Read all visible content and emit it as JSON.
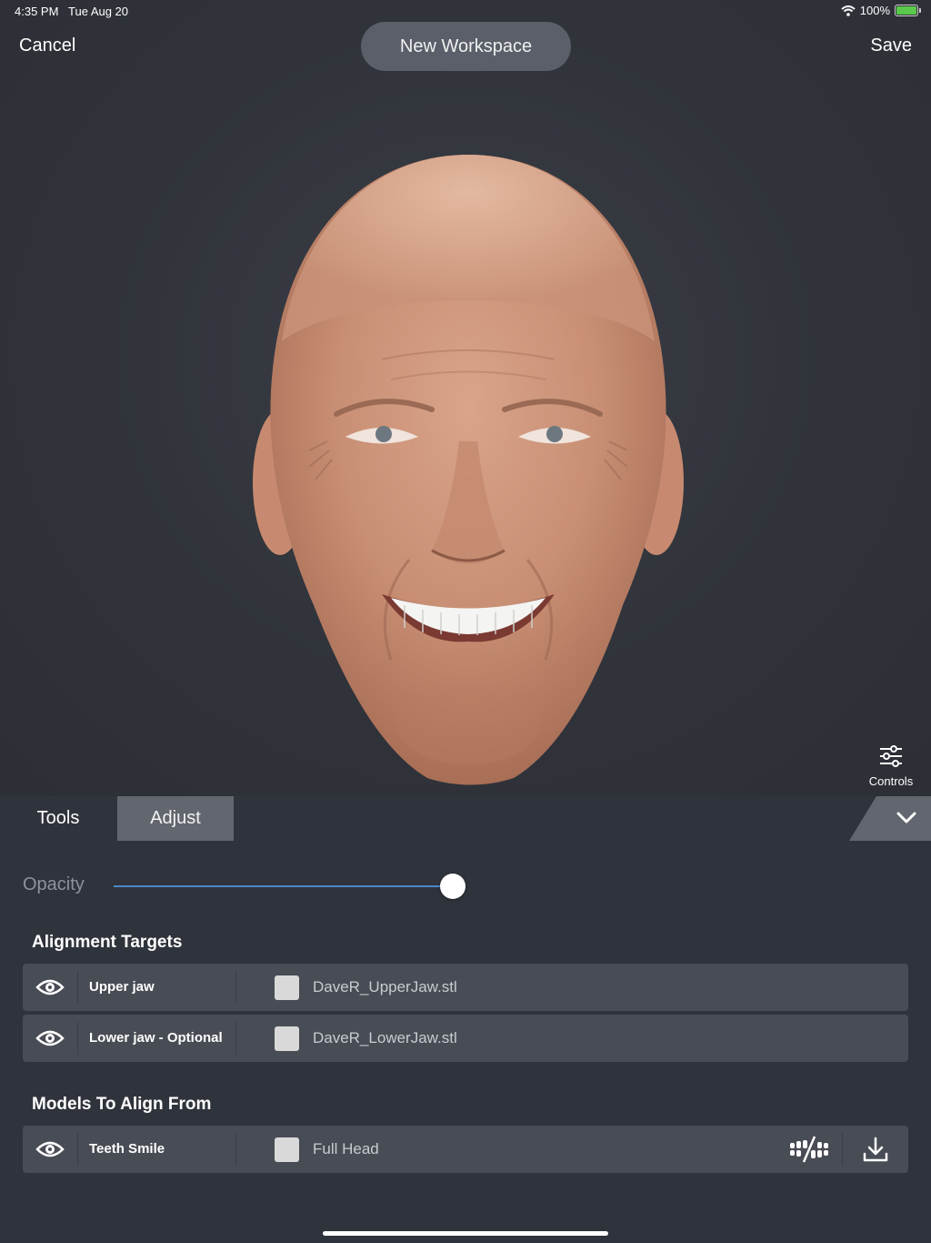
{
  "status_bar": {
    "time": "4:35 PM",
    "date": "Tue Aug 20",
    "battery": "100%",
    "icons": [
      "wifi-icon",
      "battery-charging-icon"
    ]
  },
  "nav": {
    "cancel_label": "Cancel",
    "title": "New Workspace",
    "save_label": "Save"
  },
  "viewport": {
    "model": "3D face scan",
    "controls_label": "Controls",
    "controls_icon": "sliders-icon"
  },
  "tabs": [
    {
      "label": "Tools",
      "selected": false
    },
    {
      "label": "Adjust",
      "selected": true
    }
  ],
  "collapse_icon": "chevron-down-icon",
  "panel": {
    "opacity_label": "Opacity",
    "opacity_value": 1.0,
    "alignment_targets": {
      "title": "Alignment Targets",
      "rows": [
        {
          "name": "Upper jaw",
          "file": "DaveR_UpperJaw.stl",
          "visible": true,
          "checked": false
        },
        {
          "name": "Lower jaw - Optional",
          "file": "DaveR_LowerJaw.stl",
          "visible": true,
          "checked": false
        }
      ]
    },
    "models_to_align": {
      "title": "Models To Align From",
      "rows": [
        {
          "name": "Teeth Smile",
          "file": "Full Head",
          "visible": true,
          "checked": false,
          "tools": [
            "teeth-toggle-icon",
            "download-icon"
          ]
        }
      ]
    }
  },
  "colors": {
    "background": "#2f333b",
    "row_background": "#484c55",
    "selected_tab": "#62666e",
    "slider_accent": "#4b88c8"
  }
}
